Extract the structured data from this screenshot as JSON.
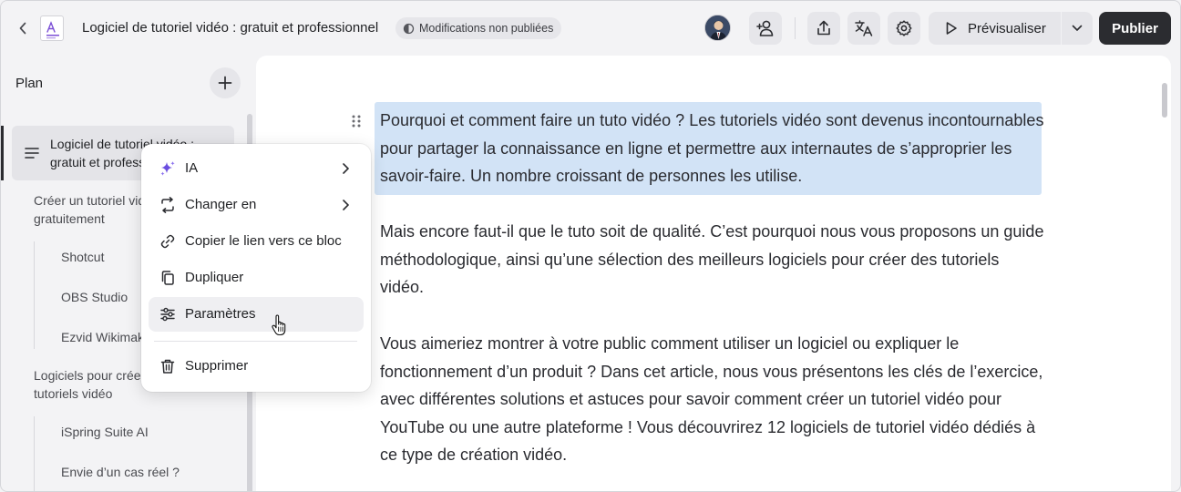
{
  "topbar": {
    "doc_title": "Logiciel de tutoriel vidéo : gratuit et professionnel",
    "status_badge": "Modifications non publiées",
    "preview_label": "Prévisualiser",
    "publish_label": "Publier",
    "icons": [
      "back-icon",
      "document-icon",
      "half-circle-icon",
      "avatar",
      "add-person-icon",
      "share-upload-icon",
      "translate-icon",
      "gear-icon",
      "play-icon",
      "chevron-down-icon"
    ]
  },
  "sidebar": {
    "title": "Plan",
    "items": [
      {
        "label_line1": "Logiciel de tutoriel vidéo :",
        "label_line2": "gratuit et professionnel",
        "level": 0,
        "selected": true
      },
      {
        "label_line1": "Créer un tutoriel vidéo",
        "label_line2": "gratuitement",
        "level": 1
      },
      {
        "label": "Shotcut",
        "level": 2
      },
      {
        "label": "OBS Studio",
        "level": 2
      },
      {
        "label": "Ezvid Wikimaker",
        "level": 2
      },
      {
        "label_line1": "Logiciels pour créer des",
        "label_line2": "tutoriels vidéo",
        "level": 1
      },
      {
        "label": "iSpring Suite AI",
        "level": 2
      },
      {
        "label": "Envie d’un cas réel ?",
        "level": 2
      }
    ]
  },
  "editor": {
    "paragraphs": [
      "Pourquoi et comment faire un tuto vidéo ? Les tutoriels vidéo sont devenus incontournables pour partager la connaissance en ligne et permettre aux internautes de s’approprier les savoir-faire. Un nombre croissant de personnes les utilise.",
      "Mais encore faut-il que le tuto soit de qualité. C’est pourquoi nous vous proposons un guide méthodologique, ainsi qu’une sélection des meilleurs logiciels pour créer des tutoriels vidéo.",
      "Vous aimeriez montrer à votre public comment utiliser un logiciel ou expliquer le fonctionnement d’un produit ? Dans cet article, nous vous présentons les clés de l’exercice, avec différentes solutions et astuces pour savoir comment créer un tutoriel vidéo pour YouTube ou une autre plateforme ! Vous découvrirez 12 logiciels de tutoriel vidéo dédiés à ce type de création vidéo."
    ]
  },
  "context_menu": {
    "items": [
      {
        "label": "IA",
        "icon": "sparkles-icon",
        "submenu": true
      },
      {
        "label": "Changer en",
        "icon": "convert-icon",
        "submenu": true
      },
      {
        "label": "Copier le lien vers ce bloc",
        "icon": "link-icon",
        "submenu": false
      },
      {
        "label": "Dupliquer",
        "icon": "duplicate-icon",
        "submenu": false
      },
      {
        "label": "Paramètres",
        "icon": "sliders-icon",
        "submenu": false,
        "hovered": true
      },
      {
        "label": "Supprimer",
        "icon": "trash-icon",
        "submenu": false
      }
    ]
  },
  "colors": {
    "accent_highlight": "#d2e3f6",
    "publish_bg": "#2b2c30",
    "ai_sparkle": "#6a4de0",
    "doc_icon_accent": "#7b4fd6"
  }
}
